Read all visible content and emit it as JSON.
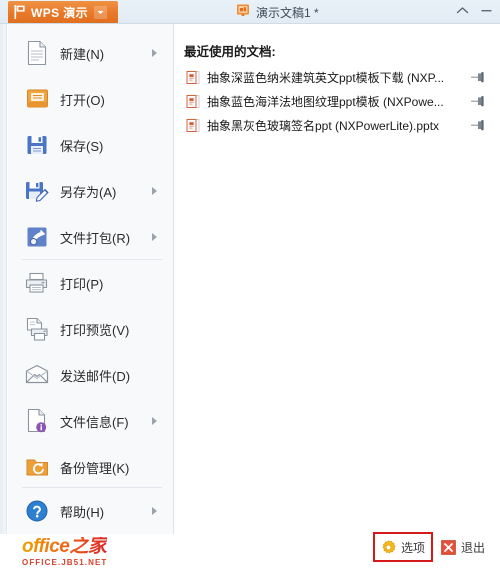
{
  "titlebar": {
    "app_button_label": "WPS 演示",
    "app_button_icon": "flag-icon",
    "app_button_caret_icon": "caret-down-icon",
    "document_icon": "presentation-icon",
    "document_title": "演示文稿1 *",
    "collapse_icon": "chevron-up-icon",
    "minimize_icon": "minimize-icon"
  },
  "sidebar": {
    "items": [
      {
        "label": "新建(N)",
        "icon": "new-document-icon",
        "has_submenu": true
      },
      {
        "label": "打开(O)",
        "icon": "open-folder-icon",
        "has_submenu": false
      },
      {
        "label": "保存(S)",
        "icon": "save-disk-icon",
        "has_submenu": false
      },
      {
        "label": "另存为(A)",
        "icon": "save-as-disk-icon",
        "has_submenu": true
      },
      {
        "label": "文件打包(R)",
        "icon": "file-package-icon",
        "has_submenu": true
      },
      {
        "label": "打印(P)",
        "icon": "printer-icon",
        "has_submenu": false
      },
      {
        "label": "打印预览(V)",
        "icon": "print-preview-icon",
        "has_submenu": false
      },
      {
        "label": "发送邮件(D)",
        "icon": "envelope-icon",
        "has_submenu": false
      },
      {
        "label": "文件信息(F)",
        "icon": "file-info-icon",
        "has_submenu": true
      },
      {
        "label": "备份管理(K)",
        "icon": "backup-folder-icon",
        "has_submenu": false
      },
      {
        "label": "帮助(H)",
        "icon": "help-question-icon",
        "has_submenu": true
      }
    ]
  },
  "recent": {
    "heading": "最近使用的文档:",
    "documents": [
      {
        "name": "抽象深蓝色纳米建筑英文ppt模板下载 (NXP...",
        "icon": "pptx-file-icon",
        "pin_icon": "pin-icon"
      },
      {
        "name": "抽象蓝色海洋法地图纹理ppt模板 (NXPowe...",
        "icon": "pptx-file-icon",
        "pin_icon": "pin-icon"
      },
      {
        "name": "抽象黑灰色玻璃签名ppt (NXPowerLite).pptx",
        "icon": "pptx-file-icon",
        "pin_icon": "pin-icon"
      }
    ]
  },
  "footer": {
    "watermark_main": "office之家",
    "watermark_sub": "OFFICE.JB51.NET",
    "options_label": "选项",
    "options_icon": "gear-icon",
    "exit_label": "退出",
    "exit_icon": "close-x-icon"
  },
  "colors": {
    "brand_orange": "#e8792a",
    "highlight_red": "#d61a1a",
    "title_bar": "#e4edf6",
    "sidebar_bg": "#f7f9fb"
  }
}
